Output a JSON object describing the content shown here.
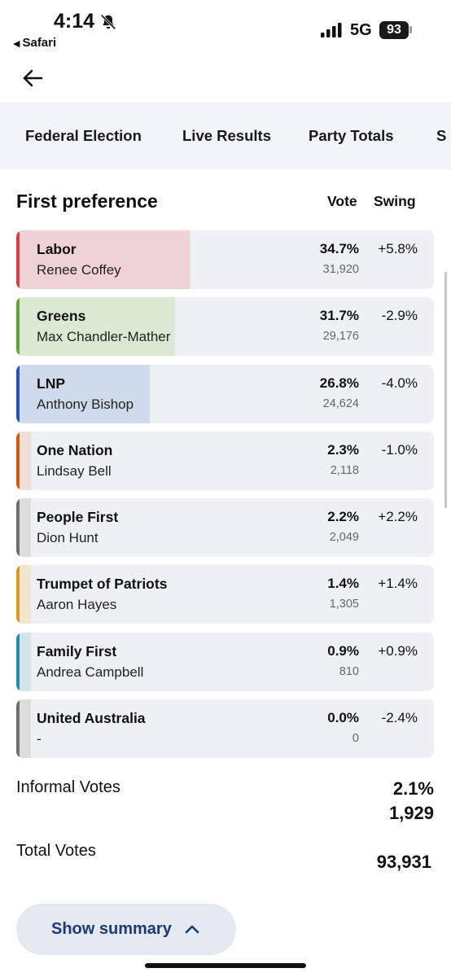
{
  "status_bar": {
    "time": "4:14",
    "back_app": "Safari",
    "network": "5G",
    "battery": "93",
    "icons": [
      "bell-slash-icon",
      "signal-icon"
    ]
  },
  "nav": {
    "back_icon": "arrow-left-icon"
  },
  "tabs": [
    {
      "label": "Federal Election"
    },
    {
      "label": "Live Results"
    },
    {
      "label": "Party Totals"
    },
    {
      "label": "S"
    }
  ],
  "table": {
    "title": "First preference",
    "col_vote": "Vote",
    "col_swing": "Swing"
  },
  "candidates": [
    {
      "party": "Labor",
      "candidate": "Renee Coffey",
      "pct": "34.7%",
      "votes": "31,920",
      "swing": "+5.8%",
      "share": 0.347,
      "color": "#d63c4b",
      "fill_color": "#efd2d6"
    },
    {
      "party": "Greens",
      "candidate": "Max Chandler-Mather",
      "pct": "31.7%",
      "votes": "29,176",
      "swing": "-2.9%",
      "share": 0.317,
      "color": "#5aa832",
      "fill_color": "#dbe9d3"
    },
    {
      "party": "LNP",
      "candidate": "Anthony Bishop",
      "pct": "26.8%",
      "votes": "24,624",
      "swing": "-4.0%",
      "share": 0.268,
      "color": "#2056b5",
      "fill_color": "#cfdaec"
    },
    {
      "party": "One Nation",
      "candidate": "Lindsay Bell",
      "pct": "2.3%",
      "votes": "2,118",
      "swing": "-1.0%",
      "share": 0.023,
      "color": "#cf5b12",
      "fill_color": "#f0dfd4"
    },
    {
      "party": "People First",
      "candidate": "Dion Hunt",
      "pct": "2.2%",
      "votes": "2,049",
      "swing": "+2.2%",
      "share": 0.022,
      "color": "#6e6e6e",
      "fill_color": "#dcdcdc"
    },
    {
      "party": "Trumpet of Patriots",
      "candidate": "Aaron Hayes",
      "pct": "1.4%",
      "votes": "1,305",
      "swing": "+1.4%",
      "share": 0.014,
      "color": "#d99a1e",
      "fill_color": "#f1e6cf"
    },
    {
      "party": "Family First",
      "candidate": "Andrea Campbell",
      "pct": "0.9%",
      "votes": "810",
      "swing": "+0.9%",
      "share": 0.009,
      "color": "#1d8fa8",
      "fill_color": "#d4e6ea"
    },
    {
      "party": "United Australia",
      "candidate": "-",
      "pct": "0.0%",
      "votes": "0",
      "swing": "-2.4%",
      "share": 0.0,
      "color": "#6e6e6e",
      "fill_color": "#dcdcdc"
    }
  ],
  "totals": {
    "informal_label": "Informal Votes",
    "informal_pct": "2.1%",
    "informal_count": "1,929",
    "total_label": "Total Votes",
    "total_count": "93,931"
  },
  "summary_button": {
    "label": "Show summary",
    "icon": "chevron-up-icon"
  }
}
